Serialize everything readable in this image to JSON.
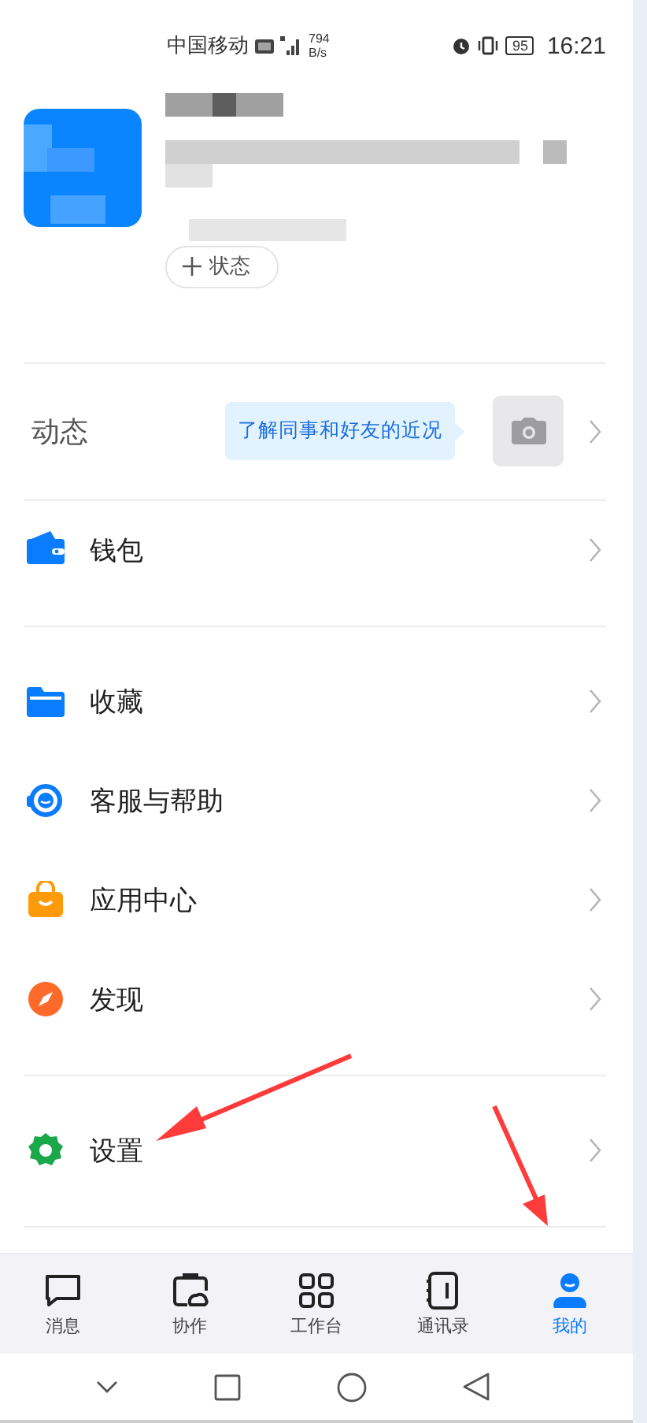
{
  "status_bar": {
    "carrier": "中国移动",
    "speed": "794",
    "speed_unit": "B/s",
    "battery": "95",
    "time": "16:21"
  },
  "profile": {
    "status_button": "状态"
  },
  "moments": {
    "label": "动态",
    "hint": "了解同事和好友的近况"
  },
  "menu_groups": [
    [
      {
        "kind": "wallet",
        "label": "钱包"
      }
    ],
    [
      {
        "kind": "favorites",
        "label": "收藏"
      },
      {
        "kind": "support",
        "label": "客服与帮助"
      },
      {
        "kind": "apps",
        "label": "应用中心"
      },
      {
        "kind": "discover",
        "label": "发现"
      }
    ],
    [
      {
        "kind": "settings",
        "label": "设置"
      }
    ]
  ],
  "tabs": [
    {
      "kind": "messages",
      "label": "消息",
      "selected": false
    },
    {
      "kind": "collab",
      "label": "协作",
      "selected": false
    },
    {
      "kind": "workbench",
      "label": "工作台",
      "selected": false
    },
    {
      "kind": "contacts",
      "label": "通讯录",
      "selected": false
    },
    {
      "kind": "me",
      "label": "我的",
      "selected": true
    }
  ]
}
